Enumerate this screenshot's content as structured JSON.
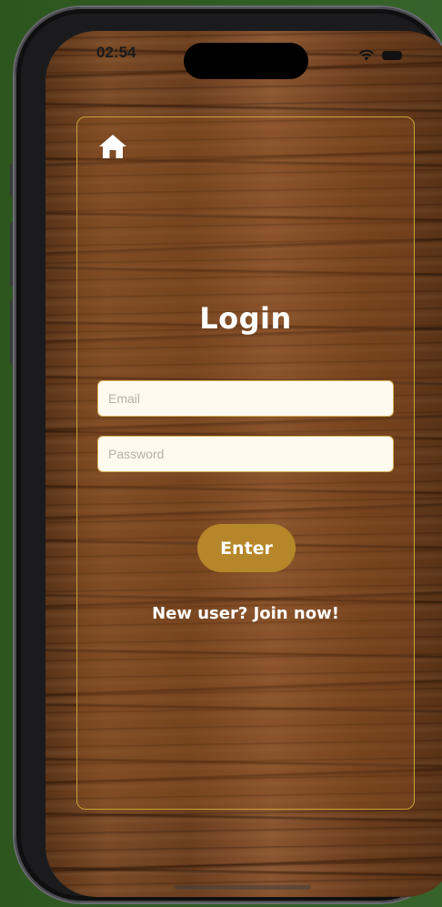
{
  "status_bar": {
    "time": "02:54",
    "wifi_icon": "wifi-icon",
    "battery_icon": "battery-icon"
  },
  "nav": {
    "home_icon": "home-icon"
  },
  "login": {
    "title": "Login",
    "email_placeholder": "Email",
    "email_value": "",
    "password_placeholder": "Password",
    "password_value": "",
    "enter_label": "Enter",
    "join_label": "New user? Join now!"
  },
  "colors": {
    "accent": "#b6872a",
    "card_border": "#c9a23a",
    "field_bg": "#fffaf0",
    "text": "#ffffff"
  }
}
